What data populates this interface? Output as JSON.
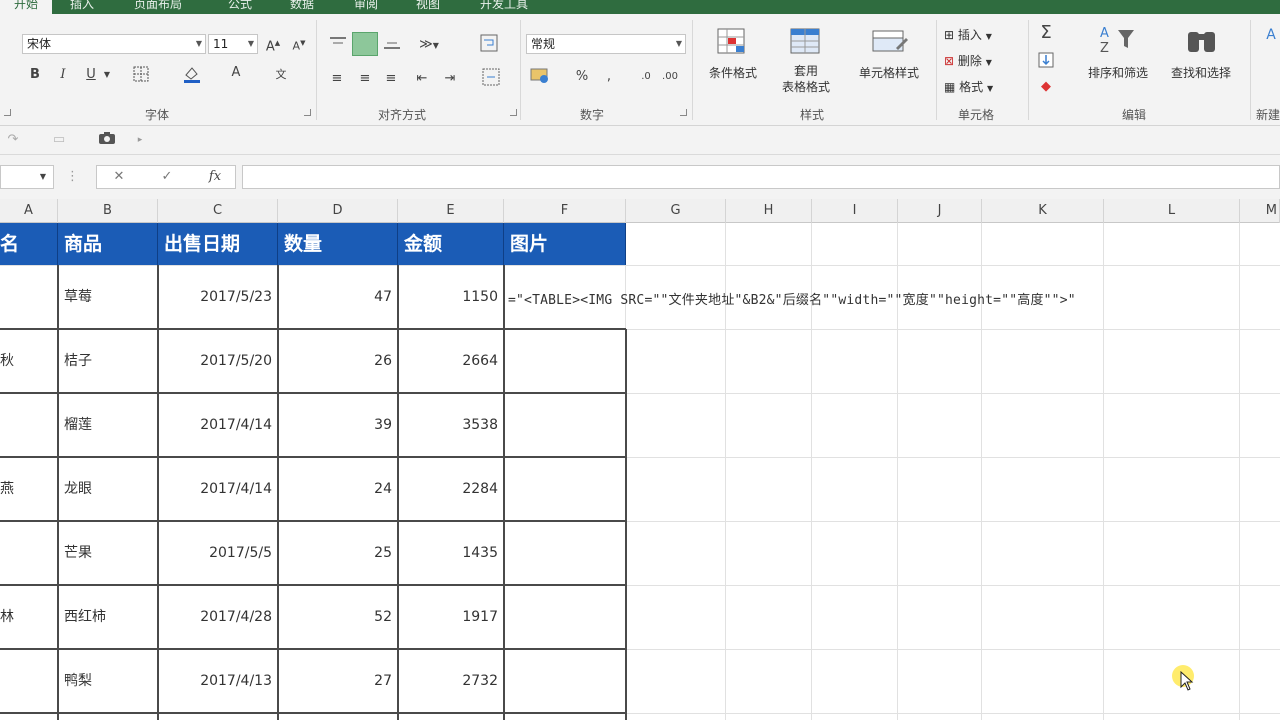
{
  "tabs": [
    {
      "label": "开始",
      "active": true
    },
    {
      "label": "插入"
    },
    {
      "label": "页面布局"
    },
    {
      "label": "公式"
    },
    {
      "label": "数据"
    },
    {
      "label": "审阅"
    },
    {
      "label": "视图"
    },
    {
      "label": "开发工具"
    }
  ],
  "font": {
    "name": "宋体",
    "size": "11",
    "group_label": "字体"
  },
  "alignment": {
    "group_label": "对齐方式"
  },
  "number": {
    "format": "常规",
    "group_label": "数字"
  },
  "styles": {
    "conditional": "条件格式",
    "table_line1": "套用",
    "table_line2": "表格格式",
    "cell_styles": "单元格样式",
    "group_label": "样式"
  },
  "cells": {
    "insert": "插入",
    "delete": "删除",
    "format": "格式",
    "group_label": "单元格"
  },
  "editing": {
    "sort": "排序和筛选",
    "find": "查找和选择",
    "group_label": "编辑"
  },
  "new_group_label": "新建",
  "formula_bar": {
    "fx": "fx",
    "cancel": "✕",
    "enter": "✓"
  },
  "columns": [
    "A",
    "B",
    "C",
    "D",
    "E",
    "F",
    "G",
    "H",
    "I",
    "J",
    "K",
    "L",
    "M"
  ],
  "table": {
    "headers": [
      "名",
      "商品",
      "出售日期",
      "数量",
      "金额",
      "图片"
    ],
    "rows": [
      {
        "a": "",
        "product": "草莓",
        "date": "2017/5/23",
        "qty": "47",
        "amount": "1150"
      },
      {
        "a": "秋",
        "product": "桔子",
        "date": "2017/5/20",
        "qty": "26",
        "amount": "2664"
      },
      {
        "a": "",
        "product": "榴莲",
        "date": "2017/4/14",
        "qty": "39",
        "amount": "3538"
      },
      {
        "a": "燕",
        "product": "龙眼",
        "date": "2017/4/14",
        "qty": "24",
        "amount": "2284"
      },
      {
        "a": "",
        "product": "芒果",
        "date": "2017/5/5",
        "qty": "25",
        "amount": "1435"
      },
      {
        "a": "林",
        "product": "西红柿",
        "date": "2017/4/28",
        "qty": "52",
        "amount": "1917"
      },
      {
        "a": "",
        "product": "鸭梨",
        "date": "2017/4/13",
        "qty": "27",
        "amount": "2732"
      }
    ]
  },
  "formula_in_cell": "=\"<TABLE><IMG SRC=\"\"文件夹地址\"&B2&\"后缀名\"\"width=\"\"宽度\"\"height=\"\"高度\"\">\""
}
